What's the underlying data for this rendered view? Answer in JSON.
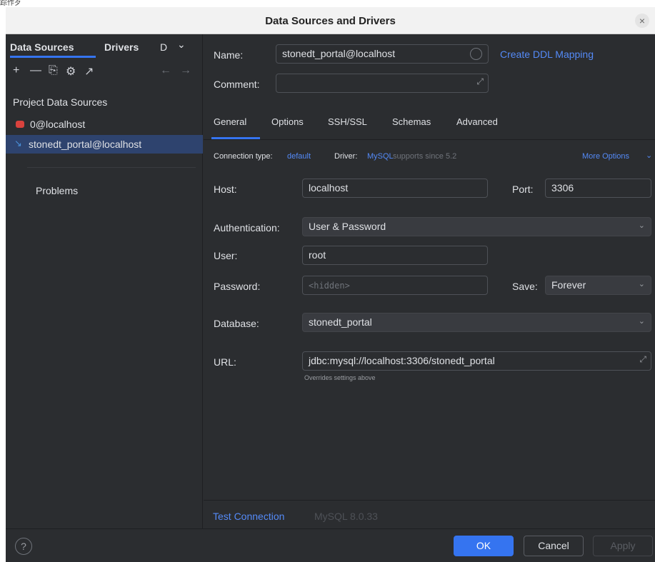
{
  "garble": "踪作歹",
  "window": {
    "title": "Data Sources and Drivers",
    "close_glyph": "×"
  },
  "left": {
    "tabs": [
      "Data Sources",
      "Drivers",
      "D"
    ],
    "tab_more_glyph": "⌄",
    "tools": [
      "+",
      "—",
      "⎘",
      "⚙",
      "↗",
      "←",
      "→"
    ],
    "section_title": "Project Data Sources",
    "items": [
      {
        "label": "0@localhost",
        "icon": "mysql-red-icon"
      },
      {
        "label": "stonedt_portal@localhost",
        "icon": "mysql-dolphin-icon",
        "selected": true
      }
    ],
    "problems": "Problems"
  },
  "form": {
    "name_label": "Name:",
    "name_value": "stonedt_portal@localhost",
    "create_ddl": "Create DDL Mapping",
    "comment_label": "Comment:",
    "comment_value": "",
    "tabs": [
      "General",
      "Options",
      "SSH/SSL",
      "Schemas",
      "Advanced"
    ],
    "active_tab": "General",
    "connection_type_label": "Connection type:",
    "connection_type_value": "default",
    "driver_label": "Driver:",
    "driver_value": "MySQL",
    "driver_note": "supports since 5.2",
    "more_options": "More Options",
    "host_label": "Host:",
    "host_value": "localhost",
    "port_label": "Port:",
    "port_value": "3306",
    "auth_label": "Authentication:",
    "auth_value": "User & Password",
    "user_label": "User:",
    "user_value": "root",
    "password_label": "Password:",
    "password_placeholder": "<hidden>",
    "save_label": "Save:",
    "save_value": "Forever",
    "database_label": "Database:",
    "database_value": "stonedt_portal",
    "url_label": "URL:",
    "url_value": "jdbc:mysql://localhost:3306/stonedt_portal",
    "url_hint": "Overrides settings above",
    "test_connection": "Test Connection",
    "server_version": "MySQL 8.0.33"
  },
  "footer": {
    "help": "?",
    "ok": "OK",
    "cancel": "Cancel",
    "apply": "Apply"
  }
}
